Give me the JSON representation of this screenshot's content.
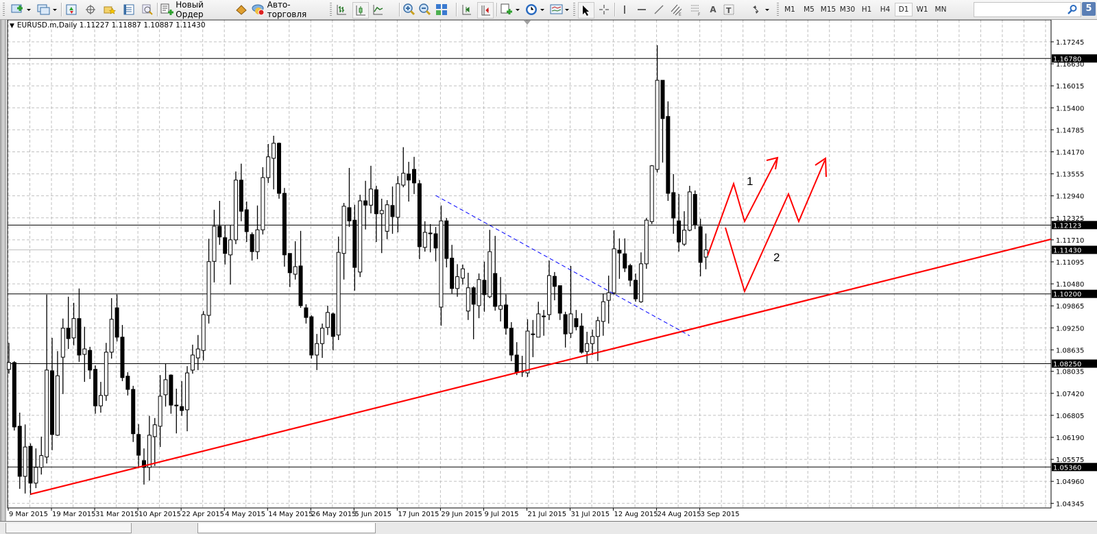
{
  "toolbar": {
    "new_order_label": "Новый Ордер",
    "autotrading_label": "Авто-торговля",
    "timeframes": [
      "M1",
      "M5",
      "M15",
      "M30",
      "H1",
      "H4",
      "D1",
      "W1",
      "MN"
    ],
    "active_timeframe": "D1",
    "search_value": "",
    "notification_count": "5"
  },
  "chart_header": {
    "symbol": "EURUSD.m,Daily",
    "open": "1.11227",
    "high": "1.11887",
    "low": "1.10887",
    "close": "1.11430"
  },
  "colors": {
    "trendline": "#ff0000",
    "channel": "#0000ff",
    "bull": "#ffffff",
    "bear": "#000000",
    "level": "#000000"
  },
  "annotations": {
    "scenario_1": "1",
    "scenario_2": "2"
  },
  "chart_data": {
    "type": "candlestick",
    "symbol": "EURUSD.m",
    "timeframe": "Daily",
    "ylim": [
      1.04345,
      1.17245
    ],
    "y_ticks": [
      "1.17245",
      "1.16630",
      "1.16015",
      "1.15400",
      "1.14785",
      "1.14170",
      "1.13555",
      "1.12940",
      "1.12325",
      "1.11710",
      "1.11095",
      "1.10480",
      "1.09865",
      "1.09250",
      "1.08635",
      "1.08035",
      "1.07420",
      "1.06805",
      "1.06190",
      "1.05575",
      "1.04960",
      "1.04345"
    ],
    "x_ticks": [
      "9 Mar 2015",
      "19 Mar 2015",
      "31 Mar 2015",
      "10 Apr 2015",
      "22 Apr 2015",
      "4 May 2015",
      "14 May 2015",
      "26 May 2015",
      "5 Jun 2015",
      "17 Jun 2015",
      "29 Jun 2015",
      "9 Jul 2015",
      "21 Jul 2015",
      "31 Jul 2015",
      "12 Aug 2015",
      "24 Aug 2015",
      "3 Sep 2015"
    ],
    "x_tick_every_bars": 8,
    "levels": [
      "1.16780",
      "1.12123",
      "1.10200",
      "1.08250",
      "1.05360"
    ],
    "current_price": "1.11430",
    "trendline": {
      "from": [
        4,
        1.046
      ],
      "to": [
        101,
        1.0826
      ]
    },
    "channel_line": {
      "from": [
        79,
        1.1295
      ],
      "to": [
        126,
        1.0903
      ]
    },
    "candles_ohlc": [
      [
        1.0809,
        1.0883,
        1.0797,
        1.0828
      ],
      [
        1.0828,
        1.0832,
        1.0638,
        1.0648
      ],
      [
        1.065,
        1.0688,
        1.0475,
        1.051
      ],
      [
        1.051,
        1.0655,
        1.0462,
        1.0592
      ],
      [
        1.0594,
        1.0602,
        1.0458,
        1.0491
      ],
      [
        1.0491,
        1.0588,
        1.0477,
        1.0535
      ],
      [
        1.0535,
        1.0621,
        1.0515,
        1.0568
      ],
      [
        1.0564,
        1.1018,
        1.0546,
        1.0807
      ],
      [
        1.0805,
        1.0897,
        1.0583,
        1.0627
      ],
      [
        1.0625,
        1.086,
        1.0623,
        1.0791
      ],
      [
        1.0843,
        1.0951,
        1.074,
        1.0924
      ],
      [
        1.0924,
        1.1012,
        1.0866,
        1.0895
      ],
      [
        1.0897,
        1.0995,
        1.0876,
        1.0951
      ],
      [
        1.0951,
        1.1035,
        1.083,
        1.0849
      ],
      [
        1.0851,
        1.0928,
        1.0774,
        1.0866
      ],
      [
        1.0862,
        1.0872,
        1.0782,
        1.0807
      ],
      [
        1.0809,
        1.082,
        1.0685,
        1.0707
      ],
      [
        1.0707,
        1.0774,
        1.0688,
        1.0736
      ],
      [
        1.0736,
        1.0883,
        1.0721,
        1.0857
      ],
      [
        1.0857,
        1.1008,
        1.0839,
        1.0949
      ],
      [
        1.0981,
        1.1018,
        1.0887,
        1.0899
      ],
      [
        1.0899,
        1.0933,
        1.0776,
        1.0786
      ],
      [
        1.079,
        1.0801,
        1.0736,
        1.0753
      ],
      [
        1.0753,
        1.0763,
        1.0606,
        1.0629
      ],
      [
        1.0627,
        1.0656,
        1.0533,
        1.0569
      ],
      [
        1.0554,
        1.0588,
        1.0487,
        1.0535
      ],
      [
        1.0535,
        1.0679,
        1.0498,
        1.0625
      ],
      [
        1.0621,
        1.0673,
        1.0539,
        1.0654
      ],
      [
        1.065,
        1.0793,
        1.0592,
        1.0734
      ],
      [
        1.0738,
        1.0824,
        1.0705,
        1.078
      ],
      [
        1.0793,
        1.0795,
        1.0685,
        1.0709
      ],
      [
        1.0709,
        1.0755,
        1.063,
        1.0707
      ],
      [
        1.0705,
        1.0776,
        1.0679,
        1.0694
      ],
      [
        1.0696,
        1.0818,
        1.0636,
        1.0799
      ],
      [
        1.0807,
        1.0878,
        1.0797,
        1.0849
      ],
      [
        1.0841,
        1.0905,
        1.0807,
        1.0866
      ],
      [
        1.0862,
        1.0972,
        1.0834,
        1.0962
      ],
      [
        1.096,
        1.1174,
        1.0937,
        1.111
      ],
      [
        1.1111,
        1.1255,
        1.1052,
        1.1209
      ],
      [
        1.1209,
        1.128,
        1.1157,
        1.1179
      ],
      [
        1.1177,
        1.1211,
        1.1102,
        1.1133
      ],
      [
        1.1129,
        1.1211,
        1.1046,
        1.1171
      ],
      [
        1.1171,
        1.1362,
        1.1159,
        1.1338
      ],
      [
        1.1338,
        1.1384,
        1.1223,
        1.1251
      ],
      [
        1.1255,
        1.1278,
        1.1165,
        1.1194
      ],
      [
        1.1186,
        1.1192,
        1.1113,
        1.1138
      ],
      [
        1.1138,
        1.1267,
        1.1117,
        1.1199
      ],
      [
        1.1199,
        1.1374,
        1.1186,
        1.1345
      ],
      [
        1.1345,
        1.1439,
        1.133,
        1.1403
      ],
      [
        1.1399,
        1.1462,
        1.1312,
        1.1441
      ],
      [
        1.1441,
        1.1443,
        1.1286,
        1.1301
      ],
      [
        1.1301,
        1.1316,
        1.1096,
        1.1129
      ],
      [
        1.1133,
        1.1133,
        1.1039,
        1.1079
      ],
      [
        1.1075,
        1.1167,
        1.106,
        1.1096
      ],
      [
        1.1098,
        1.1196,
        1.0981,
        1.0987
      ],
      [
        1.0981,
        1.0991,
        1.0937,
        1.0954
      ],
      [
        1.0956,
        1.096,
        1.0839,
        1.0849
      ],
      [
        1.0849,
        1.0908,
        1.0807,
        1.0881
      ],
      [
        1.0881,
        1.0937,
        1.0841,
        1.0924
      ],
      [
        1.0926,
        1.0987,
        1.0905,
        1.0968
      ],
      [
        1.0964,
        1.0968,
        1.0862,
        1.0901
      ],
      [
        1.0905,
        1.118,
        1.0891,
        1.1136
      ],
      [
        1.1133,
        1.1274,
        1.106,
        1.1265
      ],
      [
        1.1261,
        1.1372,
        1.1207,
        1.1224
      ],
      [
        1.1226,
        1.1269,
        1.1029,
        1.1094
      ],
      [
        1.1081,
        1.1297,
        1.1067,
        1.128
      ],
      [
        1.128,
        1.1336,
        1.12,
        1.1268
      ],
      [
        1.1268,
        1.1378,
        1.1245,
        1.1313
      ],
      [
        1.1311,
        1.1322,
        1.1165,
        1.1244
      ],
      [
        1.1244,
        1.1286,
        1.1134,
        1.1253
      ],
      [
        1.1195,
        1.1282,
        1.1173,
        1.1269
      ],
      [
        1.1267,
        1.132,
        1.1188,
        1.1236
      ],
      [
        1.1234,
        1.1349,
        1.1192,
        1.1328
      ],
      [
        1.1324,
        1.143,
        1.1318,
        1.1357
      ],
      [
        1.1355,
        1.1389,
        1.1278,
        1.1338
      ],
      [
        1.1368,
        1.1403,
        1.1299,
        1.133
      ],
      [
        1.1328,
        1.1338,
        1.1117,
        1.1152
      ],
      [
        1.115,
        1.1223,
        1.1138,
        1.1192
      ],
      [
        1.119,
        1.1215,
        1.1136,
        1.1188
      ],
      [
        1.1188,
        1.1207,
        1.1111,
        1.1148
      ],
      [
        1.0983,
        1.1267,
        1.0931,
        1.1224
      ],
      [
        1.1224,
        1.1232,
        1.1094,
        1.1119
      ],
      [
        1.112,
        1.1157,
        1.1021,
        1.1035
      ],
      [
        1.1035,
        1.1103,
        1.1012,
        1.1068
      ],
      [
        1.1064,
        1.1102,
        1.1046,
        1.109
      ],
      [
        1.0972,
        1.1079,
        1.0947,
        1.1037
      ],
      [
        1.1037,
        1.1041,
        1.0893,
        1.0991
      ],
      [
        1.0987,
        1.1077,
        1.0952,
        1.106
      ],
      [
        1.1058,
        1.111,
        1.097,
        1.1018
      ],
      [
        1.1012,
        1.1199,
        1.1008,
        1.1138
      ],
      [
        1.1077,
        1.1182,
        1.0973,
        1.0985
      ],
      [
        1.0977,
        1.1067,
        1.0943,
        1.0987
      ],
      [
        1.0989,
        1.1018,
        1.0906,
        1.0924
      ],
      [
        1.0924,
        1.0941,
        1.0832,
        1.0849
      ],
      [
        1.0849,
        1.0885,
        1.0793,
        1.0801
      ],
      [
        1.0803,
        1.0847,
        1.0788,
        1.0801
      ],
      [
        1.0799,
        1.0949,
        1.0788,
        1.0916
      ],
      [
        1.0908,
        1.0947,
        1.0843,
        1.0906
      ],
      [
        1.0899,
        1.0998,
        1.0899,
        1.0964
      ],
      [
        1.0958,
        1.0975,
        1.0903,
        1.0956
      ],
      [
        1.0962,
        1.1113,
        1.0947,
        1.1071
      ],
      [
        1.1069,
        1.1081,
        1.1002,
        1.1041
      ],
      [
        1.1043,
        1.1043,
        1.0947,
        1.0966
      ],
      [
        1.0962,
        1.097,
        1.087,
        1.0908
      ],
      [
        1.091,
        1.1098,
        1.0897,
        1.0964
      ],
      [
        1.0951,
        1.0975,
        1.0918,
        1.0928
      ],
      [
        1.093,
        1.0966,
        1.0853,
        1.0857
      ],
      [
        1.0859,
        1.0914,
        1.0826,
        1.0881
      ],
      [
        1.0881,
        1.092,
        1.0849,
        1.0901
      ],
      [
        1.0901,
        1.0956,
        1.0832,
        1.0945
      ],
      [
        1.0943,
        1.1021,
        1.0903,
        1.0998
      ],
      [
        1.1002,
        1.1071,
        1.0937,
        1.1023
      ],
      [
        1.1023,
        1.1198,
        1.1018,
        1.1146
      ],
      [
        1.1142,
        1.1175,
        1.1062,
        1.1134
      ],
      [
        1.1132,
        1.1175,
        1.1081,
        1.1092
      ],
      [
        1.1099,
        1.1104,
        1.1041,
        1.1058
      ],
      [
        1.1058,
        1.1077,
        1.0998,
        1.1006
      ],
      [
        1.0998,
        1.1136,
        1.0995,
        1.1104
      ],
      [
        1.1104,
        1.1232,
        1.109,
        1.1226
      ],
      [
        1.1222,
        1.138,
        1.1215,
        1.1378
      ],
      [
        1.1368,
        1.1715,
        1.1359,
        1.1617
      ],
      [
        1.1617,
        1.1617,
        1.1387,
        1.151
      ],
      [
        1.1516,
        1.1558,
        1.128,
        1.1301
      ],
      [
        1.1303,
        1.1355,
        1.1188,
        1.1232
      ],
      [
        1.1224,
        1.1299,
        1.1138,
        1.1165
      ],
      [
        1.1159,
        1.1251,
        1.1154,
        1.1198
      ],
      [
        1.1198,
        1.1322,
        1.1195,
        1.1305
      ],
      [
        1.1298,
        1.1309,
        1.1201,
        1.1214
      ],
      [
        1.1208,
        1.123,
        1.1069,
        1.1108
      ],
      [
        1.11227,
        1.11887,
        1.10887,
        1.1143
      ]
    ]
  }
}
